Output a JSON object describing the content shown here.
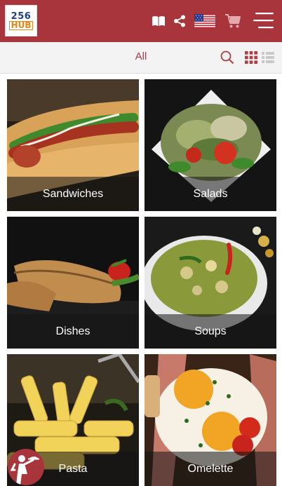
{
  "app": {
    "logo_line1": "256",
    "logo_line2": "HUB",
    "brand_color": "#a8343c"
  },
  "header": {
    "icons": [
      "menu-book-icon",
      "share-icon",
      "us-flag-icon",
      "cart-icon",
      "hamburger-menu-icon"
    ]
  },
  "filter": {
    "selected_label": "All",
    "view_mode": "grid"
  },
  "categories": [
    {
      "label": "Sandwiches"
    },
    {
      "label": "Salads"
    },
    {
      "label": "Dishes"
    },
    {
      "label": "Soups"
    },
    {
      "label": "Pasta"
    },
    {
      "label": "Omelette"
    }
  ],
  "fab": {
    "icon": "waiter-icon"
  }
}
